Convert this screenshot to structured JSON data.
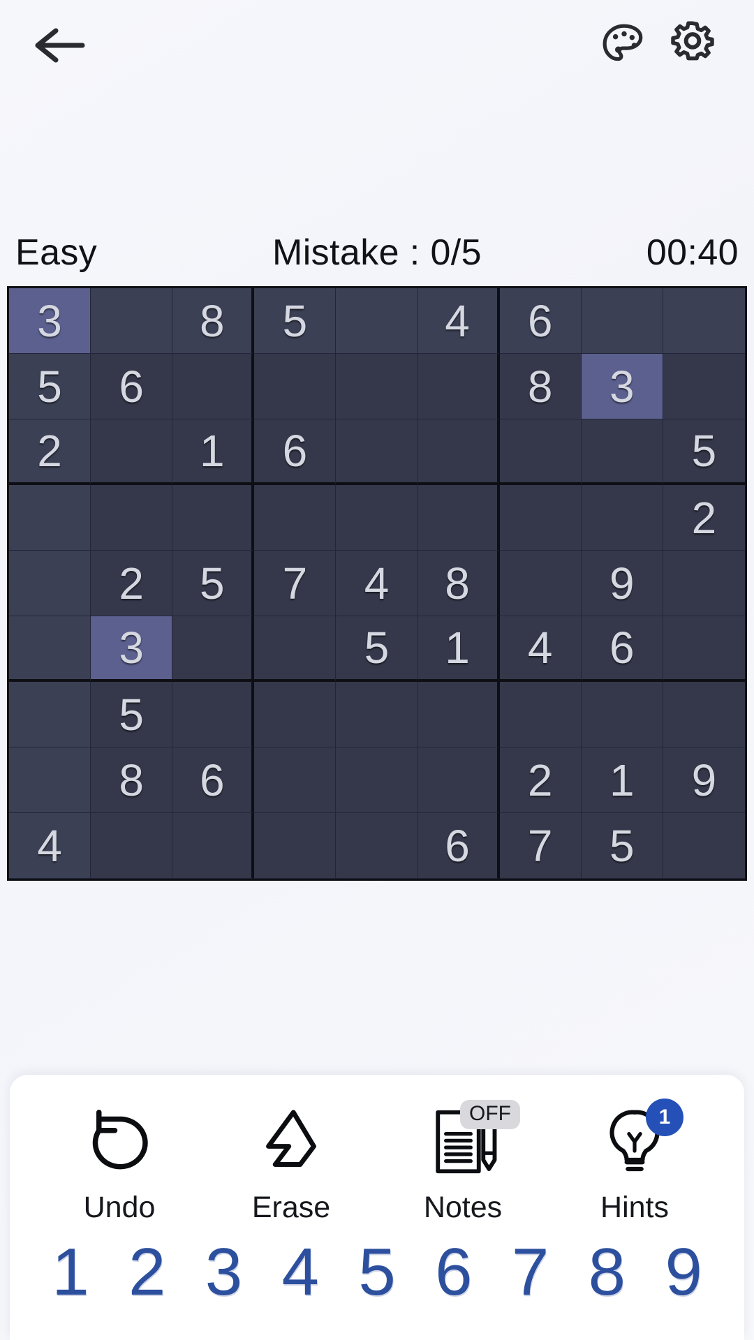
{
  "header": {
    "back_icon": "arrow-left-icon",
    "theme_icon": "palette-icon",
    "settings_icon": "gear-icon"
  },
  "status": {
    "difficulty": "Easy",
    "mistakes": "Mistake : 0/5",
    "timer": "00:40"
  },
  "board": {
    "selected_value": "3",
    "selected_row": 0,
    "selected_col": 0,
    "colors": {
      "cell_bg": "#34384a",
      "cell_highlight": "#3b4055",
      "cell_selected": "#5c608f",
      "grid_line": "#0e0f14",
      "digit": "#d5d8e0"
    },
    "rows": [
      [
        "3",
        "",
        "8",
        "5",
        "",
        "4",
        "6",
        "",
        ""
      ],
      [
        "5",
        "6",
        "",
        "",
        "",
        "",
        "8",
        "3",
        ""
      ],
      [
        "2",
        "",
        "1",
        "6",
        "",
        "",
        "",
        "",
        "5"
      ],
      [
        "",
        "",
        "",
        "",
        "",
        "",
        "",
        "",
        "2"
      ],
      [
        "",
        "2",
        "5",
        "7",
        "4",
        "8",
        "",
        "9",
        ""
      ],
      [
        "",
        "3",
        "",
        "",
        "5",
        "1",
        "4",
        "6",
        ""
      ],
      [
        "",
        "5",
        "",
        "",
        "",
        "",
        "",
        "",
        ""
      ],
      [
        "",
        "8",
        "6",
        "",
        "",
        "",
        "2",
        "1",
        "9"
      ],
      [
        "4",
        "",
        "",
        "",
        "",
        "6",
        "7",
        "5",
        ""
      ]
    ],
    "selected_cells": [
      [
        0,
        0
      ],
      [
        1,
        7
      ],
      [
        5,
        1
      ]
    ],
    "highlighted_rows": [
      0
    ],
    "highlighted_cols": [
      0
    ]
  },
  "actions": [
    {
      "label": "Undo",
      "icon": "undo-icon",
      "badge": null,
      "badge_type": null
    },
    {
      "label": "Erase",
      "icon": "eraser-icon",
      "badge": null,
      "badge_type": null
    },
    {
      "label": "Notes",
      "icon": "notes-icon",
      "badge": "OFF",
      "badge_type": "text"
    },
    {
      "label": "Hints",
      "icon": "bulb-icon",
      "badge": "1",
      "badge_type": "count"
    }
  ],
  "numpad": [
    "1",
    "2",
    "3",
    "4",
    "5",
    "6",
    "7",
    "8",
    "9"
  ]
}
